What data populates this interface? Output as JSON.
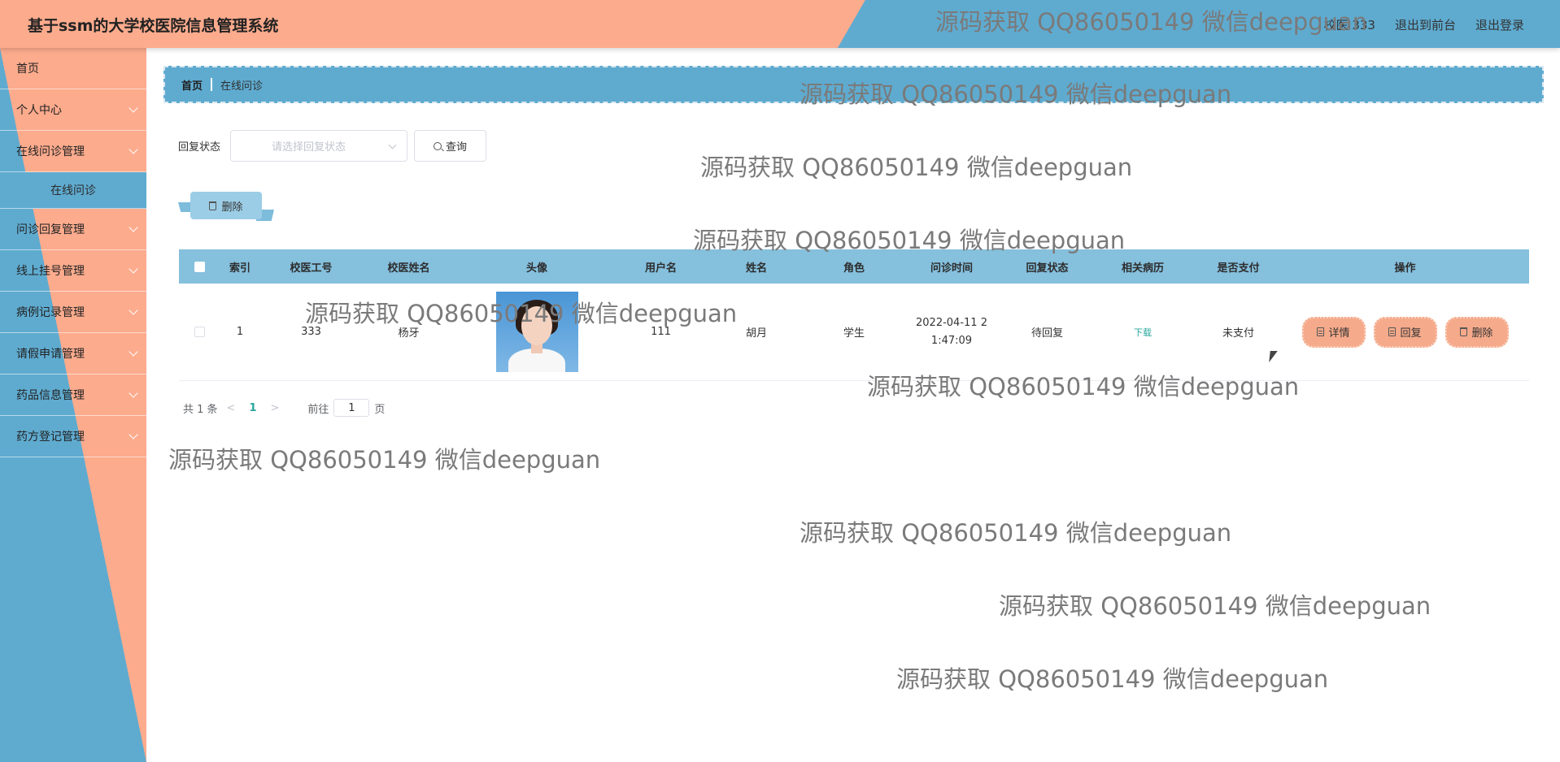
{
  "header": {
    "title": "基于ssm的大学校医院信息管理系统",
    "user_label": "校医 333",
    "front_link": "退出到前台",
    "logout_link": "退出登录"
  },
  "sidebar": {
    "items": [
      {
        "label": "首页"
      },
      {
        "label": "个人中心"
      },
      {
        "label": "在线问诊管理"
      },
      {
        "label": "在线问诊"
      },
      {
        "label": "问诊回复管理"
      },
      {
        "label": "线上挂号管理"
      },
      {
        "label": "病例记录管理"
      },
      {
        "label": "请假申请管理"
      },
      {
        "label": "药品信息管理"
      },
      {
        "label": "药方登记管理"
      }
    ]
  },
  "breadcrumb": {
    "home": "首页",
    "current": "在线问诊"
  },
  "filter": {
    "label": "回复状态",
    "placeholder": "请选择回复状态",
    "query_label": "查询"
  },
  "bulk_delete_label": "删除",
  "table": {
    "headers": [
      "索引",
      "校医工号",
      "校医姓名",
      "头像",
      "用户名",
      "姓名",
      "角色",
      "问诊时间",
      "回复状态",
      "相关病历",
      "是否支付",
      "操作"
    ],
    "rows": [
      {
        "index": "1",
        "doctor_id": "333",
        "doctor_name": "杨牙",
        "username": "111",
        "name": "胡月",
        "role": "学生",
        "time": "2022-04-11 2\n1:47:09",
        "status": "待回复",
        "case_link": "下载",
        "paid": "未支付",
        "ops": {
          "detail": "详情",
          "reply": "回复",
          "delete": "删除"
        }
      }
    ]
  },
  "pagination": {
    "total": "共 1 条",
    "prev": "<",
    "current": "1",
    "next": ">",
    "goto": "前往",
    "page_input": "1",
    "page_unit": "页"
  },
  "watermark_text": "源码获取 QQ86050149 微信deepguan",
  "colors": {
    "salmon": "#fcab8d",
    "blue": "#5fabd0",
    "table_head": "#85c0dd",
    "link_green": "#26a69a"
  }
}
